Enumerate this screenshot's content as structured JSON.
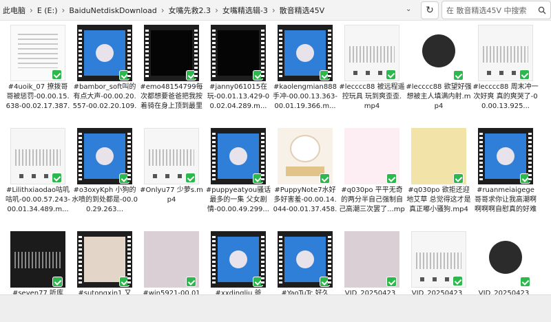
{
  "breadcrumb": [
    "此电脑",
    "E (E:)",
    "BaiduNetdiskDownload",
    "女嘴先救2.3",
    "女嘴精选辑-3",
    "散音精选45V"
  ],
  "search": {
    "placeholder": "在 散音精选45V 中搜索"
  },
  "files": [
    {
      "name": "#4uoik_07 撩拨哥哥被惩罚-00.00.15.638-00.02.17.387.m...",
      "thumb": "paper-icon"
    },
    {
      "name": "#bambor_soft叫的有点大声-00.00.20.557-00.02.20.109.m...",
      "thumb": "video-avatar"
    },
    {
      "name": "#emo48154799每次都想要爸爸把我按着骑在身上顶到最里面...",
      "thumb": "video-black"
    },
    {
      "name": "#janny061015在玩-00.01.13.429-00.02.04.289.m...",
      "thumb": "video-black"
    },
    {
      "name": "#kaolengmian888 手冲-00.00.13.363-00.01.19.366.m...",
      "thumb": "video-avatar"
    },
    {
      "name": "#lecccc88 被远程遥控玩具 玩到爽歪歪.mp4",
      "thumb": "phone-audio"
    },
    {
      "name": "#lecccc88 欲望好强想被主人填满内射.mp4",
      "thumb": "avatar-dark"
    },
    {
      "name": "#lecccc88 周末冲一次好爽 真的爽哭了-00.00.13.925...",
      "thumb": "phone-audio"
    },
    {
      "name": "#Lilithxiaodao咕叽咕叽-00.00.57.243-00.01.34.489.m...",
      "thumb": "phone-audio"
    },
    {
      "name": "#o3oxyKph 小狗的水喷的到处都是-00.00.29.263...",
      "thumb": "video-avatar"
    },
    {
      "name": "#Onlyu77 少萝s.mp4",
      "thumb": "phone-audio"
    },
    {
      "name": "#puppyeatyou骚话最多的一集 父女剧情-00.00.49.299...",
      "thumb": "video-avatar"
    },
    {
      "name": "#PuppyNote7水好多好害羞-00.00.14.044-00.01.37.458.m...",
      "thumb": "cat-image"
    },
    {
      "name": "#q030po 平平无奇的两分半自己强制自己高潮三次罢了...mp4",
      "thumb": "pink-image"
    },
    {
      "name": "#q030po 欲拒还迎地艾草 总觉得这才是真正嘟小骚狗.mp4",
      "thumb": "dog-image"
    },
    {
      "name": "#ruanmeiaigege 哥哥求你让我高潮啊啊啊啊自慰真的好难满...",
      "thumb": "video-avatar"
    },
    {
      "name": "#seven77 听库",
      "thumb": "dark-audio"
    },
    {
      "name": "#sutongxin1 又",
      "thumb": "video-picture"
    },
    {
      "name": "#wjn5921-00.01",
      "thumb": "picture"
    },
    {
      "name": "#xxdingliu 爸",
      "thumb": "video-avatar"
    },
    {
      "name": "#YaoTuTc 好久",
      "thumb": "video-avatar"
    },
    {
      "name": "VID_20250423_",
      "thumb": "picture"
    },
    {
      "name": "VID_20250423_",
      "thumb": "phone-audio"
    },
    {
      "name": "VID_20250423_",
      "thumb": "avatar-dark"
    }
  ],
  "icons": {
    "refresh": "refresh-icon",
    "search": "search-icon",
    "dropdown": "chevron-down-icon",
    "sync": "sync-check-icon"
  },
  "colors": {
    "accent": "#2f7ed8",
    "sync_badge": "#2db84e"
  }
}
